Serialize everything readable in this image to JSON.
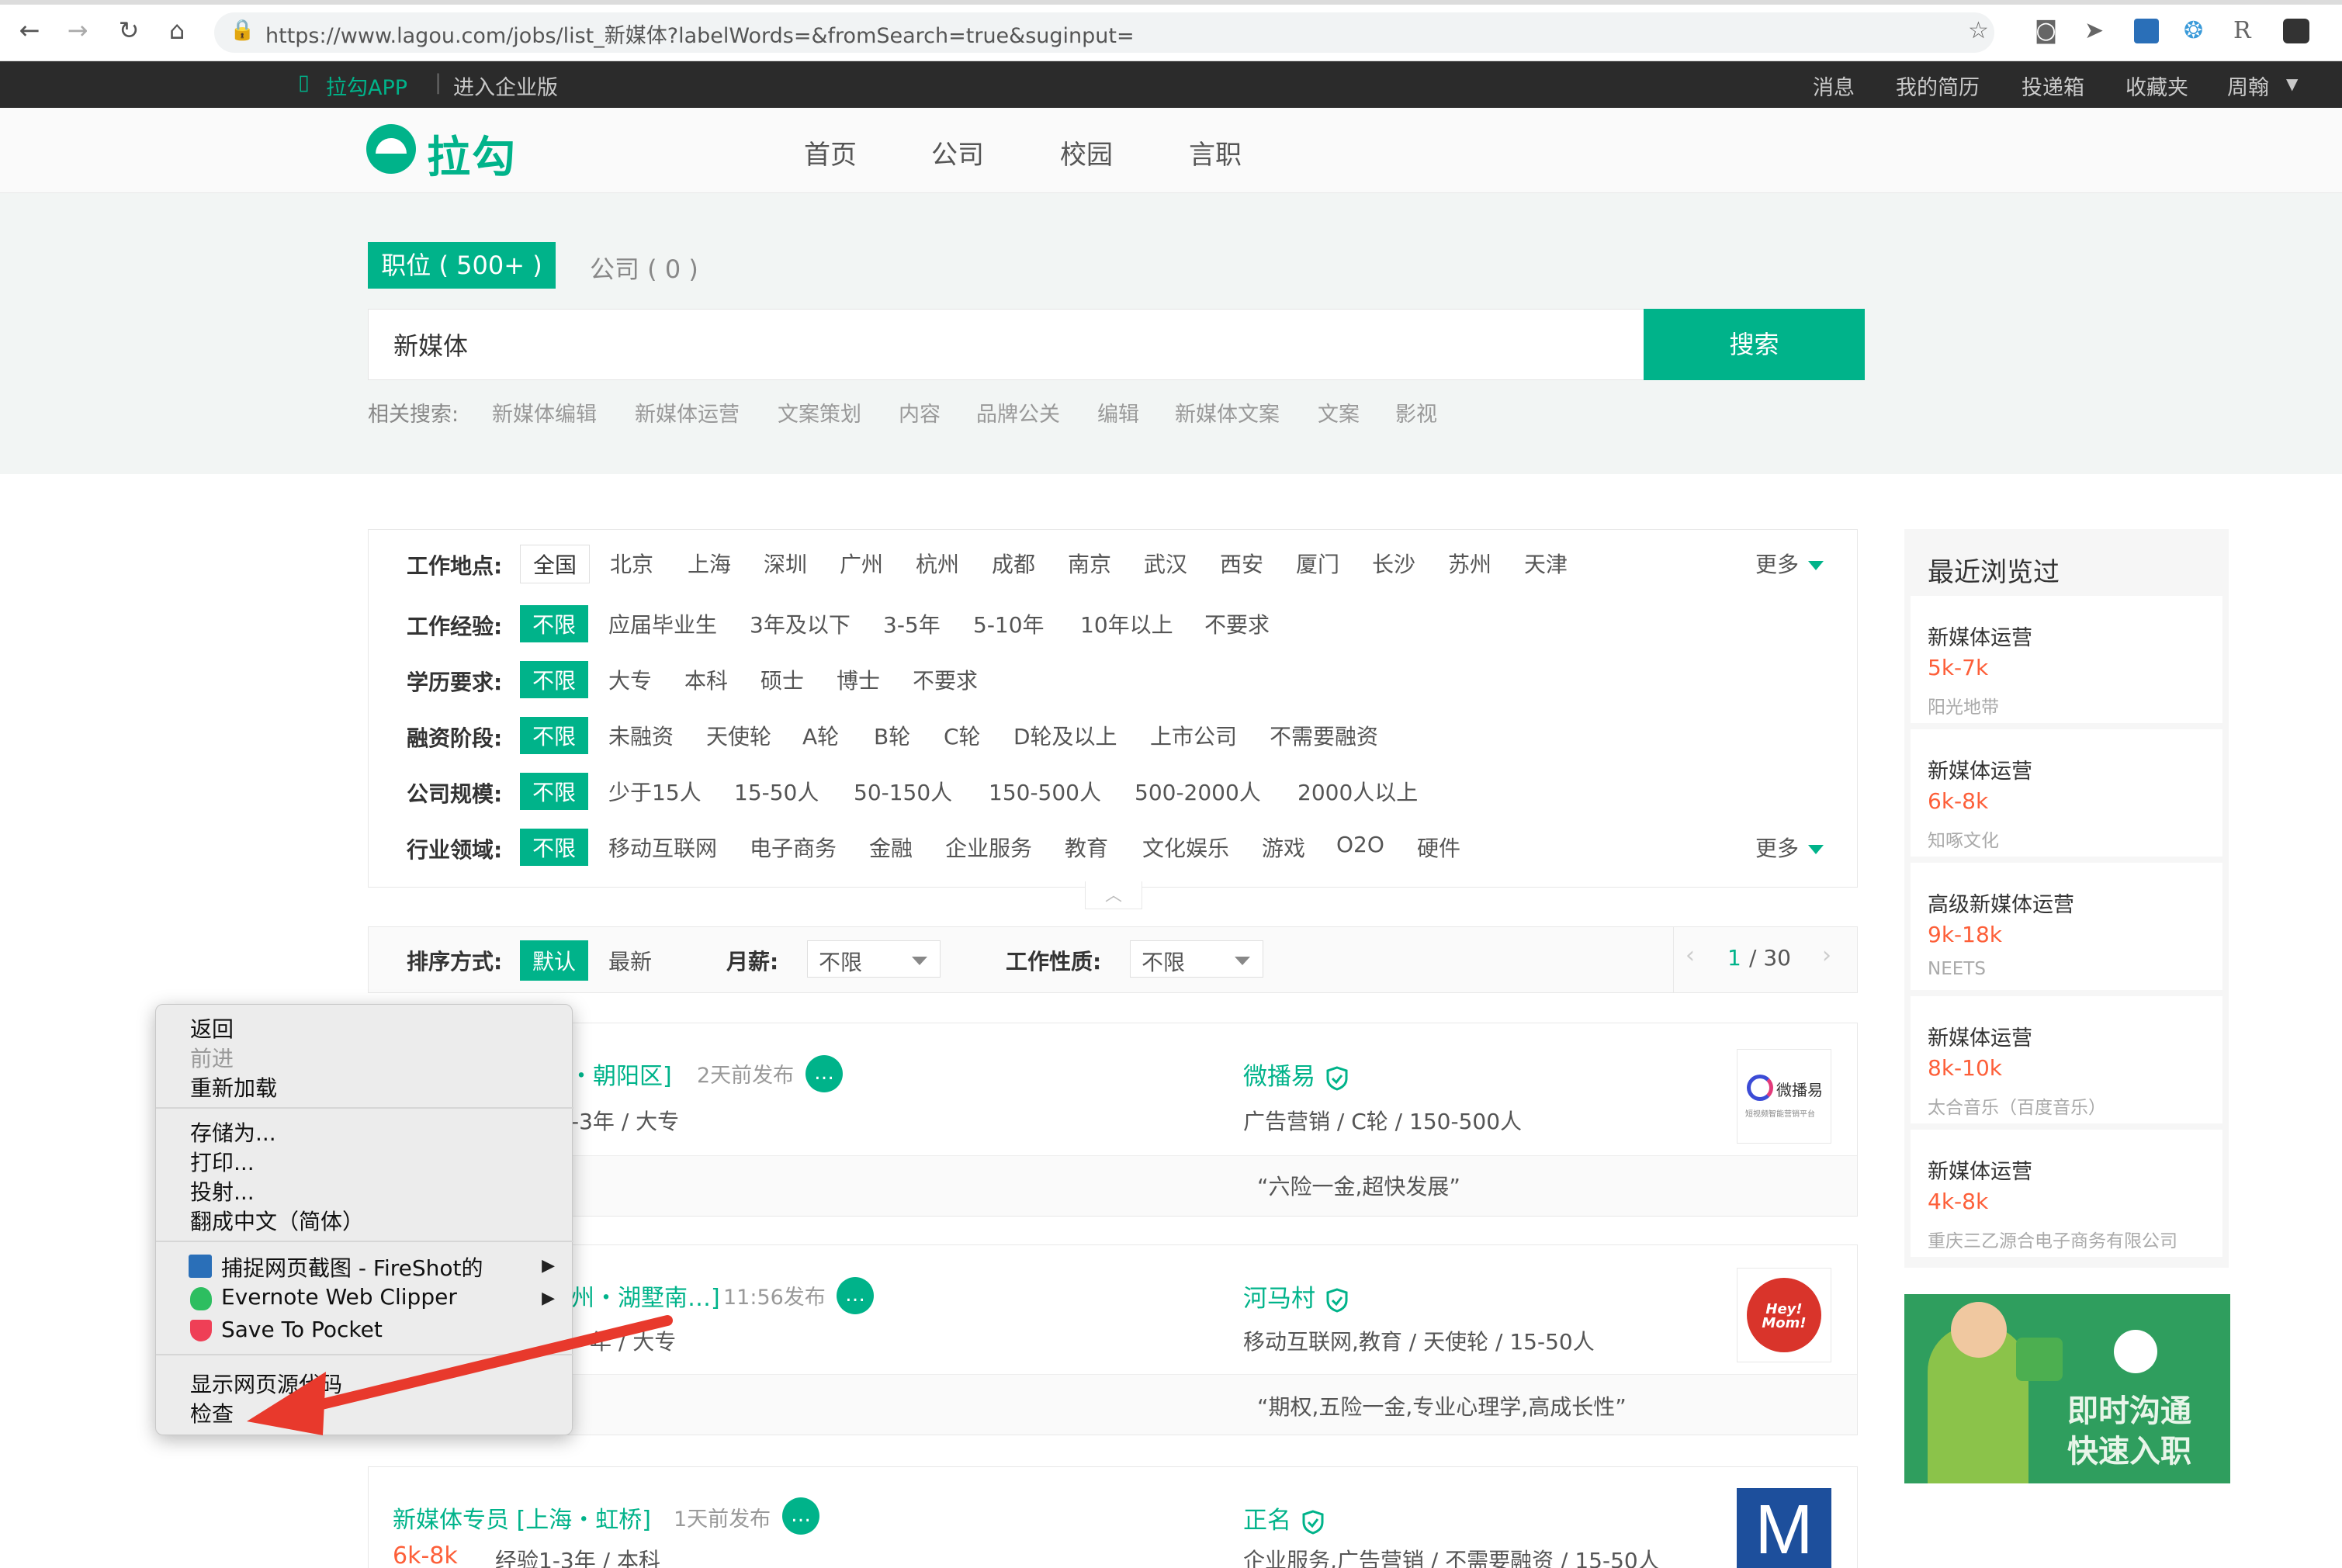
{
  "browser": {
    "url": "https://www.lagou.com/jobs/list_新媒体?labelWords=&fromSearch=true&suginput="
  },
  "topbar": {
    "app_label": "拉勾APP",
    "enterprise": "进入企业版",
    "right": [
      "消息",
      "我的简历",
      "投递箱",
      "收藏夹",
      "周翰"
    ]
  },
  "header": {
    "logo": "拉勾",
    "nav": [
      "首页",
      "公司",
      "校园",
      "言职"
    ]
  },
  "search": {
    "tab_jobs": "职位 ( 500+ )",
    "tab_company": "公司 ( 0 )",
    "query": "新媒体",
    "button": "搜索",
    "related_label": "相关搜索:",
    "related": [
      "新媒体编辑",
      "新媒体运营",
      "文案策划",
      "内容",
      "品牌公关",
      "编辑",
      "新媒体文案",
      "文案",
      "影视"
    ]
  },
  "filters": {
    "location_label": "工作地点:",
    "locations": [
      "全国",
      "北京",
      "上海",
      "深圳",
      "广州",
      "杭州",
      "成都",
      "南京",
      "武汉",
      "西安",
      "厦门",
      "长沙",
      "苏州",
      "天津"
    ],
    "more": "更多",
    "experience_label": "工作经验:",
    "experience": [
      "不限",
      "应届毕业生",
      "3年及以下",
      "3-5年",
      "5-10年",
      "10年以上",
      "不要求"
    ],
    "education_label": "学历要求:",
    "education": [
      "不限",
      "大专",
      "本科",
      "硕士",
      "博士",
      "不要求"
    ],
    "funding_label": "融资阶段:",
    "funding": [
      "不限",
      "未融资",
      "天使轮",
      "A轮",
      "B轮",
      "C轮",
      "D轮及以上",
      "上市公司",
      "不需要融资"
    ],
    "size_label": "公司规模:",
    "size": [
      "不限",
      "少于15人",
      "15-50人",
      "50-150人",
      "150-500人",
      "500-2000人",
      "2000人以上"
    ],
    "industry_label": "行业领域:",
    "industry": [
      "不限",
      "移动互联网",
      "电子商务",
      "金融",
      "企业服务",
      "教育",
      "文化娱乐",
      "游戏",
      "O2O",
      "硬件"
    ],
    "collapse_glyph": "︿"
  },
  "sort": {
    "label": "排序方式:",
    "default": "默认",
    "newest": "最新",
    "salary_label": "月薪:",
    "salary_value": "不限",
    "nature_label": "工作性质:",
    "nature_value": "不限",
    "page_current": "1",
    "page_total": "/ 30"
  },
  "jobs": [
    {
      "title_tail": "京・朝阳区]",
      "time": "2天前发布",
      "req": "-3年 / 大专",
      "company": "微播易",
      "comp_info": "广告营销 / C轮 / 150-500人",
      "perk": "“六险一金,超快发展”",
      "logo_text": "微播易",
      "logo_sub": "短视频智能营销平台"
    },
    {
      "title_tail": "州・湖墅南…]",
      "time": "11:56发布",
      "req": "年 / 大专",
      "company": "河马村",
      "comp_info": "移动互联网,教育 / 天使轮 / 15-50人",
      "perk": "“期权,五险一金,专业心理学,高成长性”",
      "logo_text": "Hey! Mom!"
    },
    {
      "title": "新媒体专员 [上海・虹桥]",
      "time": "1天前发布",
      "salary": "6k-8k",
      "req": "经验1-3年 / 本科",
      "company": "正名",
      "comp_info": "企业服务,广告营销 / 不需要融资 / 15-50人",
      "logo_text": "M"
    }
  ],
  "recent": {
    "title": "最近浏览过",
    "items": [
      {
        "title": "新媒体运营",
        "salary": "5k-7k",
        "company": "阳光地带"
      },
      {
        "title": "新媒体运营",
        "salary": "6k-8k",
        "company": "知啄文化"
      },
      {
        "title": "高级新媒体运营",
        "salary": "9k-18k",
        "company": "NEETS"
      },
      {
        "title": "新媒体运营",
        "salary": "8k-10k",
        "company": "太合音乐（百度音乐）"
      },
      {
        "title": "新媒体运营",
        "salary": "4k-8k",
        "company": "重庆三乙源合电子商务有限公司"
      }
    ],
    "ad_line1": "即时沟通",
    "ad_line2": "快速入职"
  },
  "context_menu": {
    "back": "返回",
    "forward": "前进",
    "reload": "重新加载",
    "save_as": "存储为...",
    "print": "打印...",
    "cast": "投射...",
    "translate": "翻成中文（简体）",
    "fireshot": "捕捉网页截图 - FireShot的",
    "evernote": "Evernote Web Clipper",
    "pocket": "Save To Pocket",
    "view_source": "显示网页源代码",
    "inspect": "检查"
  },
  "colors": {
    "brand": "#00b38a",
    "salary": "#fd5f39",
    "annotation_arrow": "#e8392c"
  }
}
